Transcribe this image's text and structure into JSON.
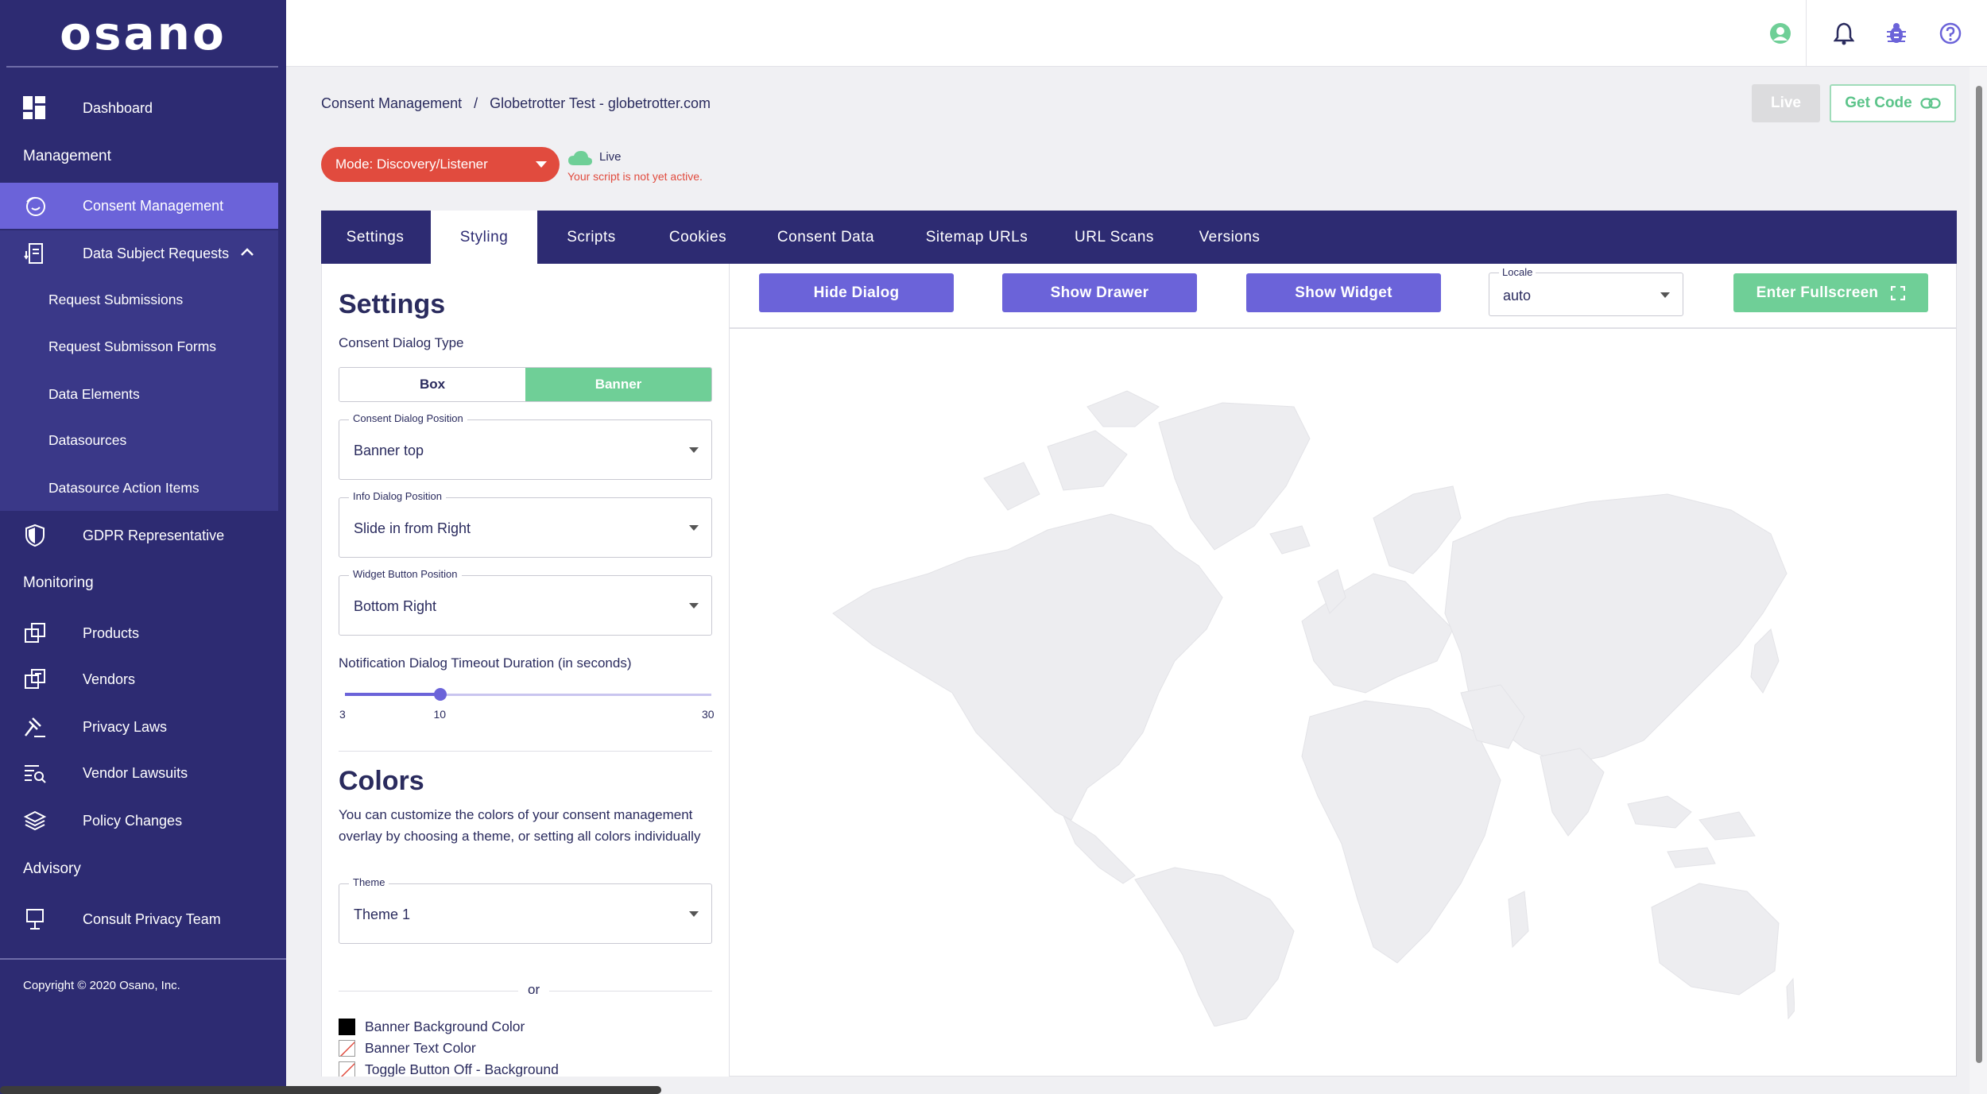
{
  "brand": {
    "logo_text": "osano",
    "primary": "#2d2b72",
    "accent": "#6b63d9",
    "danger": "#e14b3e",
    "success": "#6fcf97"
  },
  "sidebar": {
    "dashboard": "Dashboard",
    "section_management": "Management",
    "consent_management": "Consent Management",
    "data_subject_requests": "Data Subject Requests",
    "dsr_items": [
      "Request Submissions",
      "Request Submisson Forms",
      "Data Elements",
      "Datasources",
      "Datasource Action Items"
    ],
    "gdpr_representative": "GDPR Representative",
    "section_monitoring": "Monitoring",
    "monitoring_items": [
      "Products",
      "Vendors",
      "Privacy Laws",
      "Vendor Lawsuits",
      "Policy Changes"
    ],
    "section_advisory": "Advisory",
    "consult_privacy_team": "Consult Privacy Team",
    "copyright": "Copyright © 2020 Osano, Inc."
  },
  "topbar": {
    "icons": [
      "user-circle-icon",
      "bell-icon",
      "bug-icon",
      "help-circle-icon"
    ]
  },
  "breadcrumb": {
    "root": "Consent Management",
    "separator": "/",
    "current": "Globetrotter Test - globetrotter.com"
  },
  "header_actions": {
    "live_label": "Live",
    "get_code_label": "Get Code"
  },
  "mode": {
    "label": "Mode: Discovery/Listener",
    "status_label": "Live",
    "status_warning": "Your script is not yet active."
  },
  "tabs": [
    "Settings",
    "Styling",
    "Scripts",
    "Cookies",
    "Consent Data",
    "Sitemap URLs",
    "URL Scans",
    "Versions"
  ],
  "active_tab": "Styling",
  "settings": {
    "heading": "Settings",
    "dialog_type_label": "Consent Dialog Type",
    "dialog_type_options": [
      "Box",
      "Banner"
    ],
    "dialog_type_selected": "Banner",
    "consent_position": {
      "legend": "Consent Dialog Position",
      "value": "Banner top"
    },
    "info_position": {
      "legend": "Info Dialog Position",
      "value": "Slide in from Right"
    },
    "widget_position": {
      "legend": "Widget Button Position",
      "value": "Bottom Right"
    },
    "timeout": {
      "label": "Notification Dialog Timeout Duration (in seconds)",
      "min": "3",
      "value": "10",
      "max": "30"
    }
  },
  "colors": {
    "heading": "Colors",
    "description": "You can customize the colors of your consent management overlay by choosing a theme, or setting all colors individually",
    "theme": {
      "legend": "Theme",
      "value": "Theme 1"
    },
    "or_label": "or",
    "items": [
      {
        "label": "Banner Background Color",
        "color": "#000000"
      },
      {
        "label": "Banner Text Color",
        "color": "none"
      },
      {
        "label": "Toggle Button Off - Background",
        "color": "none"
      }
    ]
  },
  "preview": {
    "hide_dialog": "Hide Dialog",
    "show_drawer": "Show Drawer",
    "show_widget": "Show Widget",
    "locale": {
      "legend": "Locale",
      "value": "auto"
    },
    "fullscreen": "Enter Fullscreen"
  }
}
